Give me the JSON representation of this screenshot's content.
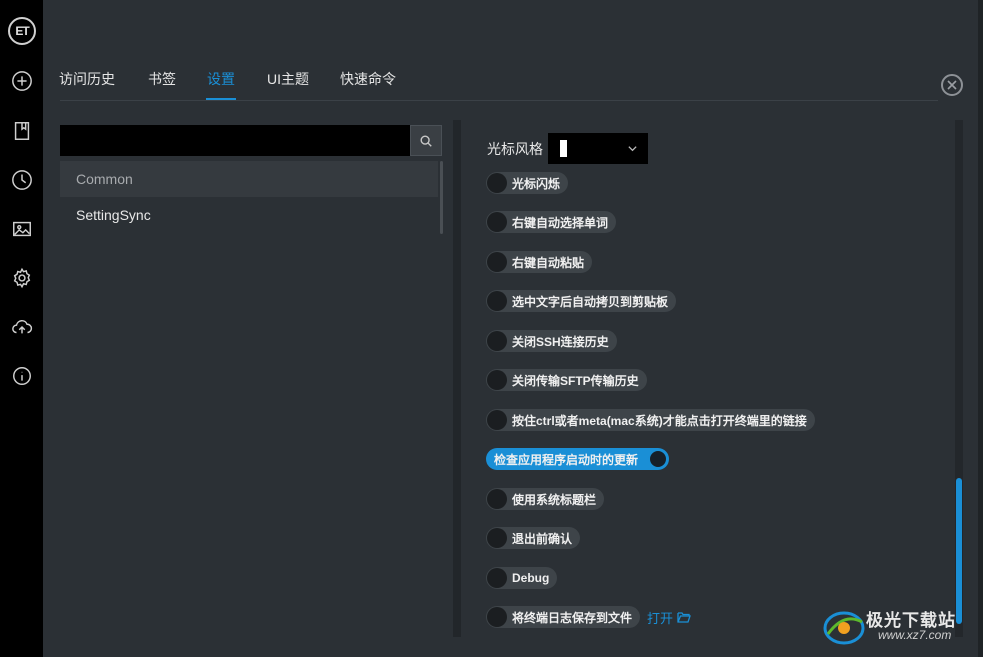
{
  "rail": {
    "logo_text": "ET",
    "icons": [
      "plus-circle-icon",
      "bookmark-icon",
      "clock-icon",
      "image-icon",
      "gear-icon",
      "cloud-sync-icon",
      "info-icon"
    ]
  },
  "tabs": [
    {
      "label": "访问历史"
    },
    {
      "label": "书签"
    },
    {
      "label": "设置",
      "active": true
    },
    {
      "label": "UI主题"
    },
    {
      "label": "快速命令"
    }
  ],
  "search": {
    "value": "",
    "placeholder": ""
  },
  "settings_list": [
    {
      "label": "Common",
      "selected": true
    },
    {
      "label": "SettingSync"
    }
  ],
  "settings": {
    "cursor_style_label": "光标风格",
    "options": [
      {
        "label": "光标闪烁",
        "on": false
      },
      {
        "label": "右键自动选择单词",
        "on": false
      },
      {
        "label": "右键自动粘贴",
        "on": false
      },
      {
        "label": "选中文字后自动拷贝到剪贴板",
        "on": false
      },
      {
        "label": "关闭SSH连接历史",
        "on": false
      },
      {
        "label": "关闭传输SFTP传输历史",
        "on": false
      },
      {
        "label": "按住ctrl或者meta(mac系统)才能点击打开终端里的链接",
        "on": false
      },
      {
        "label": "检查应用程序启动时的更新",
        "on": true
      },
      {
        "label": "使用系统标题栏",
        "on": false
      },
      {
        "label": "退出前确认",
        "on": false
      },
      {
        "label": "Debug",
        "on": false
      },
      {
        "label": "将终端日志保存到文件",
        "on": false
      }
    ],
    "open_link": "打开"
  },
  "watermark": {
    "name": "极光下载站",
    "url": "www.xz7.com"
  },
  "colors": {
    "accent": "#1a8fd6",
    "background": "#2b3035",
    "rail": "#000000"
  }
}
